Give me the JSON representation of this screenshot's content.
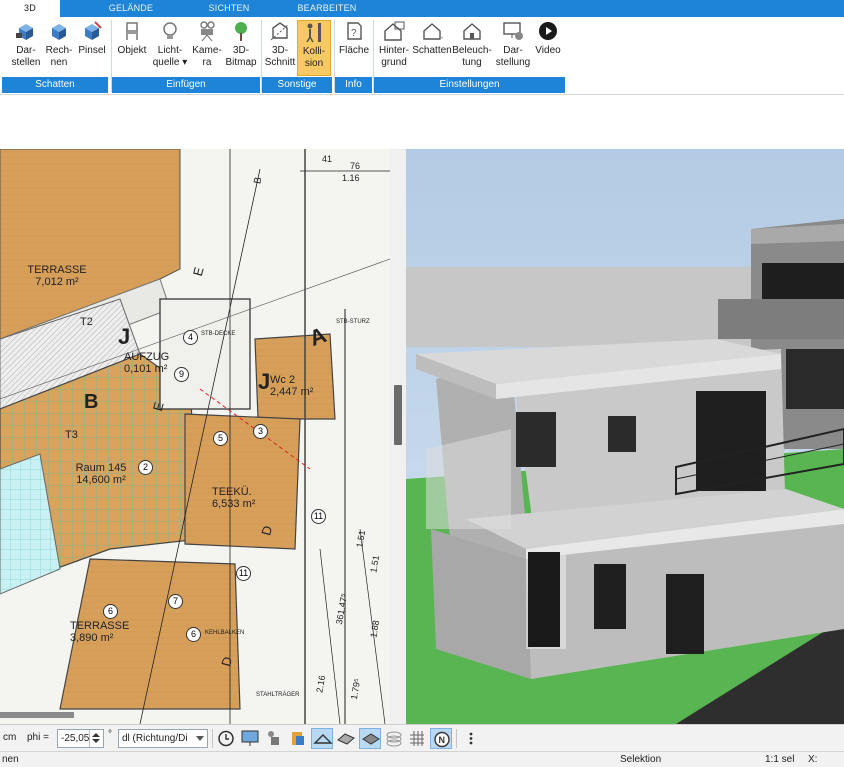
{
  "tabs": [
    {
      "label": "3D",
      "active": true
    },
    {
      "label": "GELÄNDE",
      "active": false
    },
    {
      "label": "SICHTEN",
      "active": false
    },
    {
      "label": "BEARBEITEN",
      "active": false
    }
  ],
  "ribbon": {
    "buttons": [
      {
        "id": "darstellen",
        "l1": "Dar-",
        "l2": "stellen",
        "icon": "cube-render-icon"
      },
      {
        "id": "rechnen",
        "l1": "Rech-",
        "l2": "nen",
        "icon": "cube-calc-icon"
      },
      {
        "id": "pinsel",
        "l1": "Pinsel",
        "l2": "",
        "icon": "cube-brush-icon"
      },
      {
        "id": "objekt",
        "l1": "Objekt",
        "l2": "",
        "icon": "chair-icon"
      },
      {
        "id": "lichtquelle",
        "l1": "Licht-",
        "l2": "quelle ▾",
        "icon": "lightbulb-icon"
      },
      {
        "id": "kamera",
        "l1": "Kame-",
        "l2": "ra",
        "icon": "camera-icon"
      },
      {
        "id": "bitmap3d",
        "l1": "3D-",
        "l2": "Bitmap",
        "icon": "tree-icon"
      },
      {
        "id": "schnitt3d",
        "l1": "3D-",
        "l2": "Schnitt",
        "icon": "section-icon"
      },
      {
        "id": "kollision",
        "l1": "Kolli-",
        "l2": "sion",
        "icon": "collision-icon",
        "selected": true
      },
      {
        "id": "flaeche",
        "l1": "Fläche",
        "l2": "",
        "icon": "area-info-icon"
      },
      {
        "id": "hintergrund",
        "l1": "Hinter-",
        "l2": "grund",
        "icon": "house-background-icon"
      },
      {
        "id": "schatten2",
        "l1": "Schatten",
        "l2": "",
        "icon": "house-shadow-icon"
      },
      {
        "id": "beleuchtung",
        "l1": "Beleuch-",
        "l2": "tung",
        "icon": "house-light-icon"
      },
      {
        "id": "darstellung",
        "l1": "Dar-",
        "l2": "stellung",
        "icon": "monitor-settings-icon"
      },
      {
        "id": "video",
        "l1": "Video",
        "l2": "",
        "icon": "play-circle-icon"
      }
    ],
    "groups": {
      "schatten": "Schatten",
      "einfuegen": "Einfügen",
      "sonstige": "Sonstige",
      "info": "Info",
      "einstellungen": "Einstellungen"
    }
  },
  "plan": {
    "rooms": [
      {
        "name": "TERRASSE",
        "area": "7,012 m²"
      },
      {
        "name": "AUFZUG",
        "area": "0,101 m²"
      },
      {
        "name": "Wc 2",
        "area": "2,447 m²"
      },
      {
        "name": "Raum 145",
        "area": "14,600 m²"
      },
      {
        "name": "TEEKÜ.",
        "area": "6,533 m²"
      },
      {
        "name": "TERRASSE",
        "area": "3,890 m²"
      }
    ],
    "markers": [
      "4",
      "9",
      "5",
      "3",
      "2",
      "11",
      "11",
      "6",
      "7",
      "6"
    ],
    "labels": {
      "t2": "T2",
      "t3": "T3",
      "b_left": "B",
      "b_top": "B",
      "j1": "J",
      "j2": "J",
      "e1": "E",
      "e2": "E",
      "a1": "A",
      "d1": "D",
      "d2": "D",
      "stb_sturz": "STB-STURZ",
      "stb_decke": "STB-DECKE",
      "stahltraeger": "STAHLTRÄGER",
      "kehlbalken": "KEHLBALKEN",
      "dim1": "41",
      "dim2": "76",
      "dim3": "1.16",
      "dim4": "1.51",
      "dim5": "1.51",
      "dim6": "2.16",
      "dim7": "1.79⁵",
      "dim8": "1.88",
      "dim9": "361.47⁵"
    }
  },
  "toolbar": {
    "unit": "cm",
    "phi_label": "phi =",
    "phi_value": "-25,05",
    "deg": "°",
    "dl_value": "dl (Richtung/Di",
    "buttons": [
      "clock-icon",
      "monitor-icon",
      "tool-icon",
      "paint-icon",
      "view-icon",
      "render-icon",
      "layer-icon",
      "grid-icon",
      "north-icon",
      "more-icon"
    ]
  },
  "status": {
    "left": "nen",
    "selektion": "Selektion",
    "scale": "1:1 sel",
    "coord": "X:"
  }
}
